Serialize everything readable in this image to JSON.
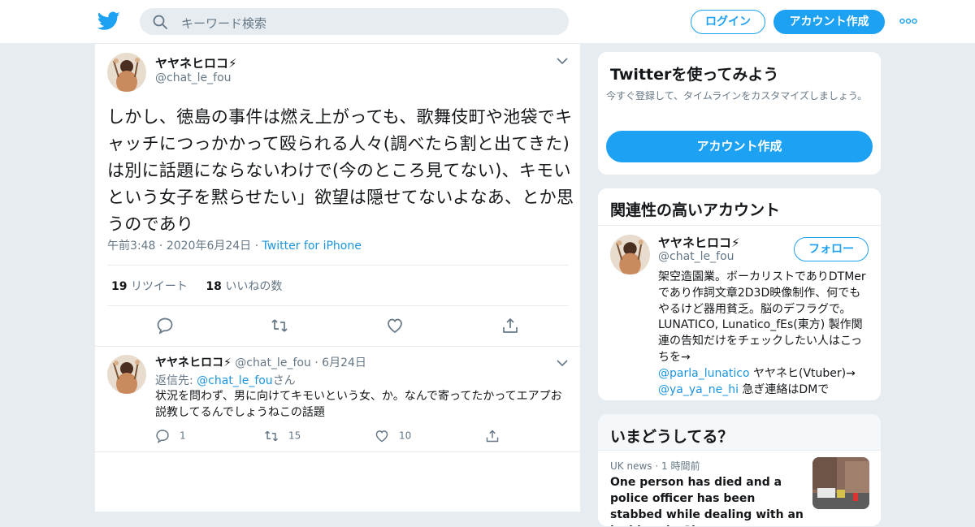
{
  "header": {
    "search_placeholder": "キーワード検索",
    "login": "ログイン",
    "signup": "アカウント作成"
  },
  "tweet": {
    "name": "ヤヤネヒロコ⚡",
    "handle": "@chat_le_fou",
    "text": "しかし、徳島の事件は燃え上がっても、歌舞伎町や池袋でキャッチにつっかかって殴られる人々(調べたら割と出てきた)は別に話題にならないわけで(今のところ見てない)、キモいという女子を黙らせたい」欲望は隠せてないよなあ、とか思うのであり",
    "time": "午前3:48",
    "date": "2020年6月24日",
    "source": "Twitter for iPhone",
    "retweets_count": "19",
    "retweets_label": "リツイート",
    "likes_count": "18",
    "likes_label": "いいねの数"
  },
  "reply": {
    "name": "ヤヤネヒロコ⚡",
    "handle": "@chat_le_fou",
    "date": "6月24日",
    "replying_prefix": "返信先: ",
    "replying_handle": "@chat_le_fou",
    "replying_suffix": "さん",
    "text": "状況を問わず、男に向けてキモいという女、か。なんで寄ってたかってエアプお説教してるんでしょうねこの話題",
    "replies": "1",
    "retweets": "15",
    "likes": "10"
  },
  "signup_card": {
    "title": "Twitterを使ってみよう",
    "subtitle": "今すぐ登録して、タイムラインをカスタマイズしましょう。",
    "button": "アカウント作成"
  },
  "related_card": {
    "title": "関連性の高いアカウント",
    "name": "ヤヤネヒロコ⚡",
    "handle": "@chat_le_fou",
    "follow": "フォロー",
    "bio_1": "架空造園業。ボーカリストでありDTMerであり作詞文章2D3D映像制作、何でもやるけど器用貧乏。脳のデフラグで。LUNATICO, Lunatico_fEs(東方) 製作関連の告知だけをチェックしたい人はこっちを→",
    "bio_link_1": "@parla_lunatico",
    "bio_2": " ヤヤネヒ(Vtuber)→",
    "bio_link_2": "@ya_ya_ne_hi",
    "bio_3": " 急ぎ連絡はDMで"
  },
  "trends_card": {
    "title": "いまどうしてる？",
    "source": "UK news",
    "age": "1 時間前",
    "headline": "One person has died and a police officer has been stabbed while dealing with an incident in Glasgow"
  },
  "colors": {
    "accent": "#1da1f2",
    "link": "#1b95e0",
    "muted": "#657786",
    "background": "#e6ecf0"
  }
}
